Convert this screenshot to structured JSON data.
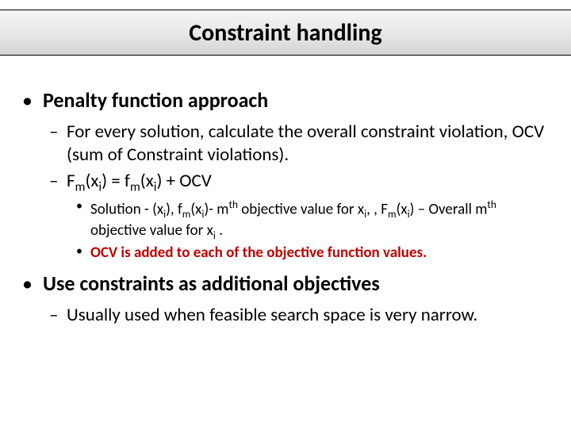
{
  "title": "Constraint handling",
  "bullets": {
    "penalty_heading": "Penalty function approach",
    "penalty_sub1_a": "For every solution, calculate the overall constraint violation, OCV (sum of Constraint violations).",
    "penalty_sub2_prefix": "F",
    "penalty_sub2_m": "m",
    "penalty_sub2_paren1": "(x",
    "penalty_sub2_i": "i",
    "penalty_sub2_mid": ") = f",
    "penalty_sub2_paren2": ") + OCV",
    "penalty_sol_a": "Solution - (x",
    "penalty_sol_b": "), f",
    "penalty_sol_c": ")- m",
    "penalty_sol_th": "th",
    "penalty_sol_d": " objective value for x",
    "penalty_sol_e": ", , F",
    "penalty_sol_f": ") – Overall m",
    "penalty_sol_g": " objective value for x",
    "penalty_sol_h": " .",
    "penalty_ocv_red": "OCV is added to each of the objective function values.",
    "constraints_heading": "Use constraints as additional objectives",
    "constraints_sub1": "Usually used when feasible search space is very narrow."
  }
}
